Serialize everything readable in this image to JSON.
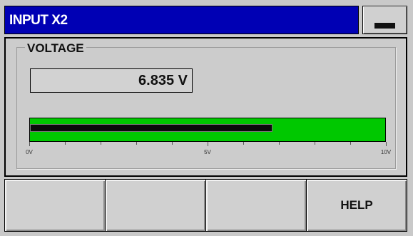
{
  "header": {
    "title": "INPUT X2",
    "mode_indicator": "dash-icon"
  },
  "group": {
    "label": "VOLTAGE",
    "readout": "6.835 V",
    "gauge": {
      "value": 6.835,
      "min": 0,
      "max": 10,
      "unit": "V",
      "fill_color": "#00c800"
    },
    "scale": {
      "min_label": "0V",
      "mid_label": "5V",
      "max_label": "10V"
    }
  },
  "softkeys": [
    "",
    "",
    "",
    "HELP"
  ],
  "colors": {
    "title_bg": "#0000b4",
    "title_text": "#ffffff",
    "gauge_bg": "#00c800",
    "gauge_bar": "#0a0a0a"
  }
}
